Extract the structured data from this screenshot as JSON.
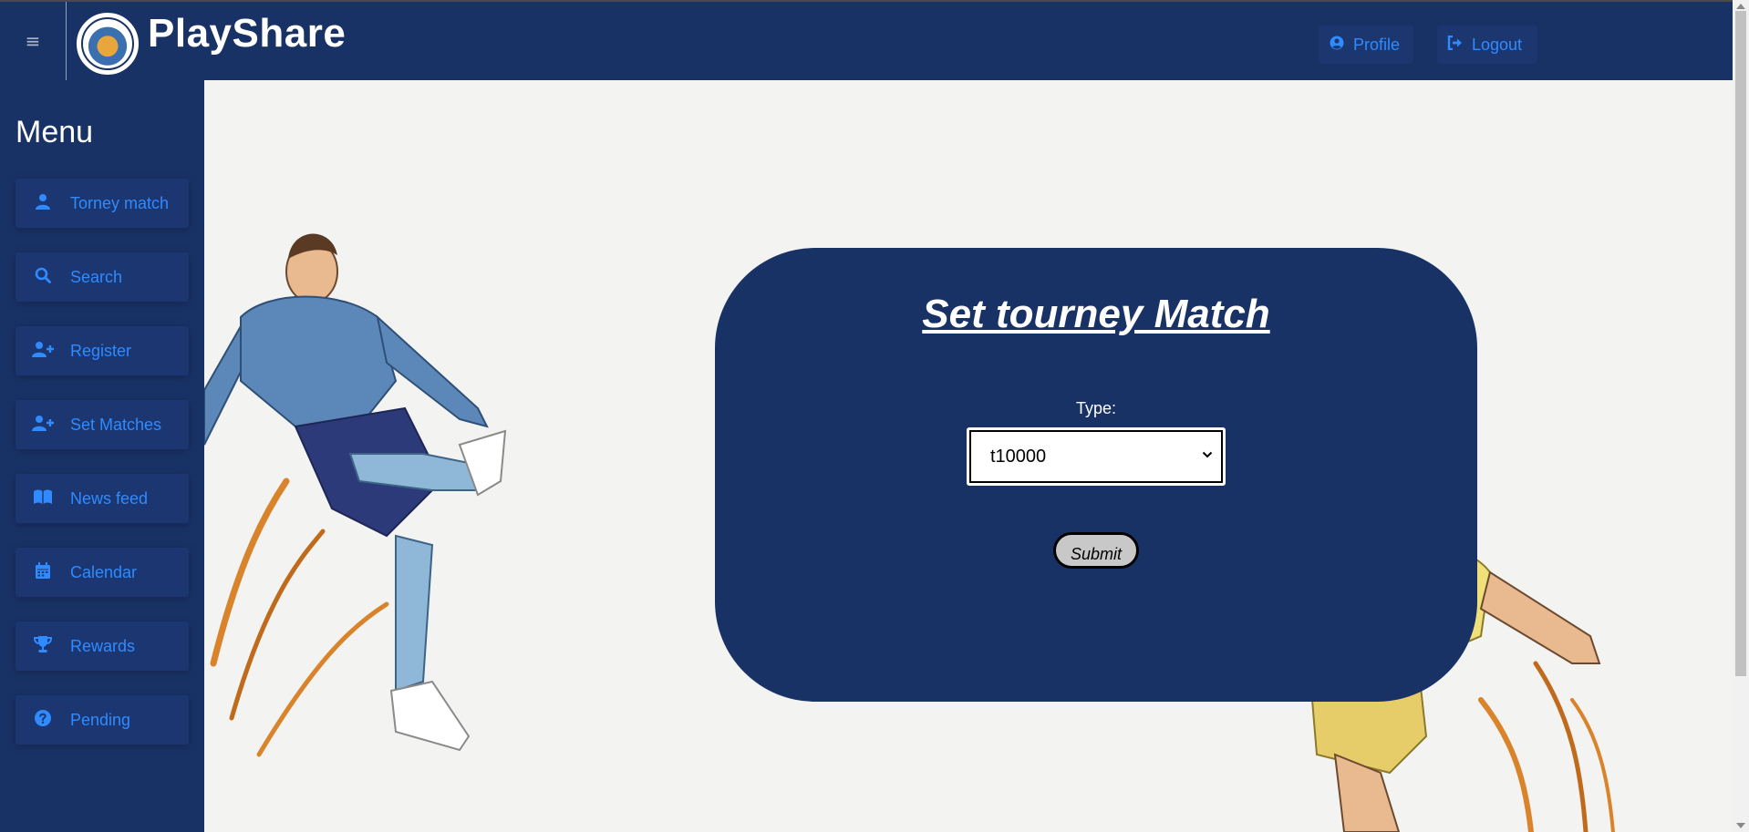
{
  "header": {
    "menu_icon": "hamburger-icon",
    "logo": "playshare-logo",
    "brand": "PlayShare",
    "profile_label": "Profile",
    "profile_icon": "user-circle-icon",
    "logout_label": "Logout",
    "logout_icon": "sign-out-icon"
  },
  "sidebar": {
    "title": "Menu",
    "items": [
      {
        "label": "Torney match",
        "icon": "user-icon"
      },
      {
        "label": "Search",
        "icon": "search-icon"
      },
      {
        "label": "Register",
        "icon": "user-plus-icon"
      },
      {
        "label": "Set Matches",
        "icon": "user-plus-icon"
      },
      {
        "label": "News feed",
        "icon": "book-open-icon"
      },
      {
        "label": "Calendar",
        "icon": "calendar-icon"
      },
      {
        "label": "Rewards",
        "icon": "trophy-icon"
      },
      {
        "label": "Pending",
        "icon": "question-circle-icon"
      }
    ]
  },
  "form": {
    "title": "Set tourney Match",
    "type_label": "Type:",
    "type_value": "t10000",
    "submit_label": "Submit"
  },
  "colors": {
    "navy": "#193266",
    "accent": "#2f8bff",
    "background": "#f3f3f2"
  }
}
